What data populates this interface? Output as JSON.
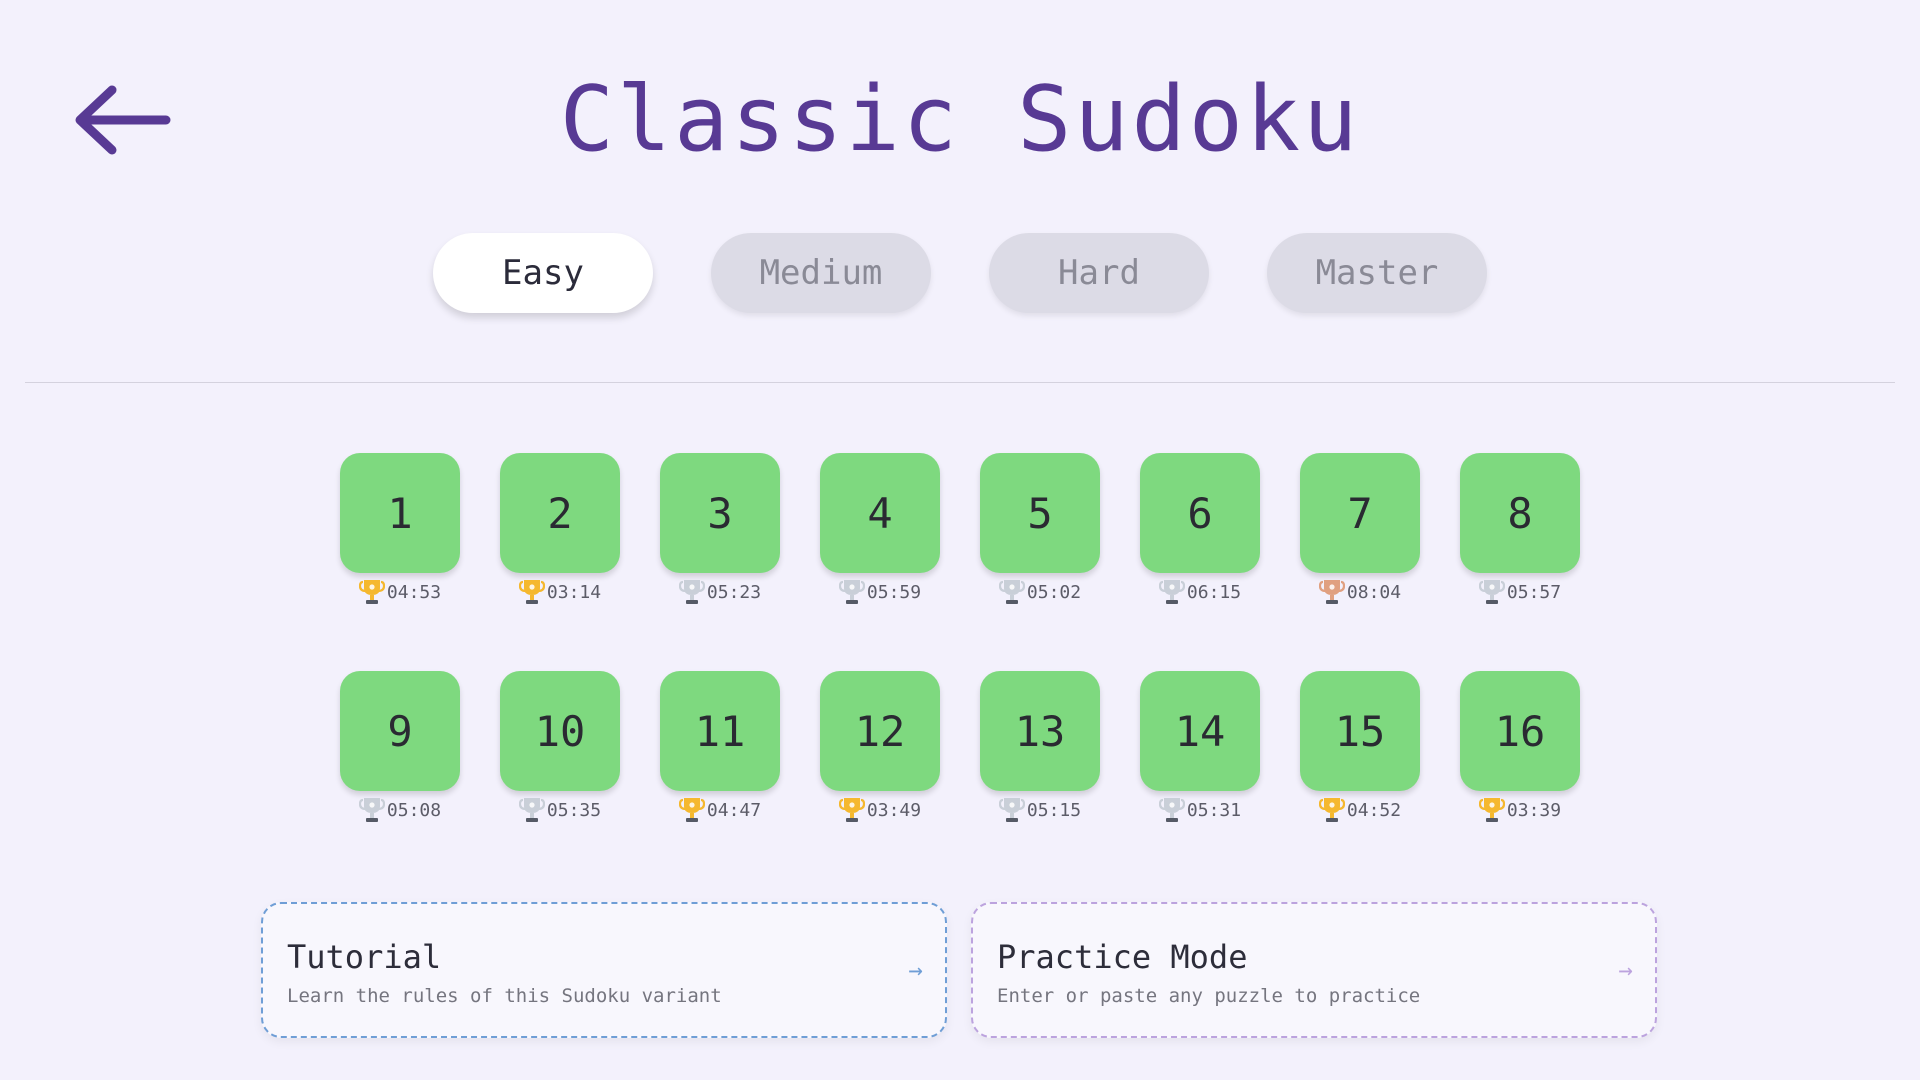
{
  "header": {
    "title": "Classic Sudoku",
    "back_icon": "arrow-left-icon",
    "accent_color": "#583a94"
  },
  "tabs": [
    {
      "label": "Easy",
      "active": true
    },
    {
      "label": "Medium",
      "active": false
    },
    {
      "label": "Hard",
      "active": false
    },
    {
      "label": "Master",
      "active": false
    }
  ],
  "levels": [
    {
      "number": "1",
      "time": "04:53",
      "trophy": "gold"
    },
    {
      "number": "2",
      "time": "03:14",
      "trophy": "gold"
    },
    {
      "number": "3",
      "time": "05:23",
      "trophy": "silver"
    },
    {
      "number": "4",
      "time": "05:59",
      "trophy": "silver"
    },
    {
      "number": "5",
      "time": "05:02",
      "trophy": "silver"
    },
    {
      "number": "6",
      "time": "06:15",
      "trophy": "silver"
    },
    {
      "number": "7",
      "time": "08:04",
      "trophy": "bronze"
    },
    {
      "number": "8",
      "time": "05:57",
      "trophy": "silver"
    },
    {
      "number": "9",
      "time": "05:08",
      "trophy": "silver"
    },
    {
      "number": "10",
      "time": "05:35",
      "trophy": "silver"
    },
    {
      "number": "11",
      "time": "04:47",
      "trophy": "gold"
    },
    {
      "number": "12",
      "time": "03:49",
      "trophy": "gold"
    },
    {
      "number": "13",
      "time": "05:15",
      "trophy": "silver"
    },
    {
      "number": "14",
      "time": "05:31",
      "trophy": "silver"
    },
    {
      "number": "15",
      "time": "04:52",
      "trophy": "gold"
    },
    {
      "number": "16",
      "time": "03:39",
      "trophy": "gold"
    }
  ],
  "trophy_colors": {
    "gold": "#f5b82e",
    "silver": "#c9cfd8",
    "bronze": "#e0a080"
  },
  "level_color": "#7ed97f",
  "cards": {
    "tutorial": {
      "title": "Tutorial",
      "description": "Learn the rules of this Sudoku variant",
      "arrow": "→"
    },
    "practice": {
      "title": "Practice Mode",
      "description": "Enter or paste any puzzle to practice",
      "arrow": "→"
    }
  }
}
